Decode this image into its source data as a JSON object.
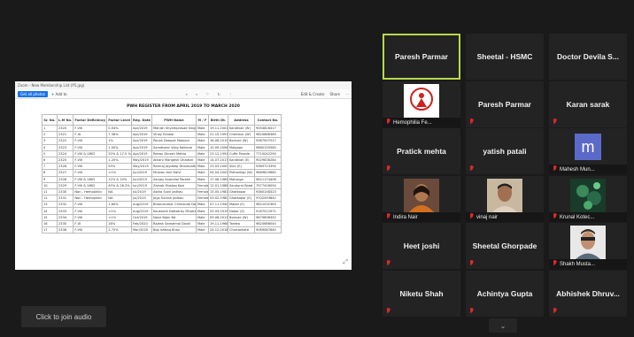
{
  "shared_window": {
    "titlebar": "Zoom - New Membership List (P5.jpg)",
    "toolbar": {
      "primary_btn": "Get all photos",
      "add": "+ Add to",
      "edit": "Edit & Create",
      "share": "Share"
    },
    "doc_title": "PWH REGISTER FROM APRIL 2019 TO MARCH 2020",
    "columns": [
      "Sr. No.",
      "L.M No.",
      "Factor Deficiency",
      "Factor Level",
      "Reg. Date",
      "PWH Name",
      "M / F",
      "Birth Dt.",
      "Address",
      "Contact No."
    ],
    "rows": [
      [
        "1",
        "2320",
        "F-VIII",
        "0.04%",
        "Apr/2019",
        "Manish Shyamprasad Singh",
        "Male",
        "19.11.2001",
        "Kandivali (W)",
        "9004826417"
      ],
      [
        "2",
        "2321",
        "F-IX",
        "7.36%",
        "Apr/2019",
        "Vinay Earwar",
        "Male",
        "21.10.1991",
        "Chembur (W)",
        "9820686389"
      ],
      [
        "3",
        "2322",
        "F-VIII",
        "1%",
        "Apr/2019",
        "Ponak Deepak Malpani",
        "Male",
        "16.08.2019",
        "Borivali (W)",
        "9987907517"
      ],
      [
        "4",
        "2323",
        "F-VIII",
        "1.00%",
        "Apr/2019",
        "Samdiseer Vijay Kolkane",
        "Male",
        "10.09.2006",
        "Malgaon",
        "9860155580"
      ],
      [
        "5",
        "2324",
        "F-VIII & VWD",
        "20% & 17.5 %",
        "Apr/2019",
        "Rohan Dinesh Mehta",
        "Male",
        "23.12.1991",
        "Cuffe Parade",
        "7710042290"
      ],
      [
        "6",
        "2325",
        "F-VIII",
        "1.20%",
        "May/2019",
        "Atharv Mangesh Ghadshi",
        "Male",
        "14.07.2017",
        "Kandivali (E)",
        "9029836284"
      ],
      [
        "7",
        "2326",
        "F-VIII",
        "59%",
        "May/2019",
        "Ramraj Jaydeep Dhoravatte",
        "Male",
        "23.03.2000",
        "Sion (E)",
        "9369723394"
      ],
      [
        "8",
        "2327",
        "F-VIII",
        "<1%",
        "Jun/2019",
        "Mravan Anil Dalvi",
        "Male",
        "04.04.2002",
        "Pidhonkap (W)",
        "9869819680"
      ],
      [
        "9",
        "2328",
        "F-VIII & VWD",
        "12% & 20%",
        "Jun/2019",
        "Sanjay Anandlal Parekh",
        "Male",
        "17.08.1965",
        "Matunga",
        "9821174406"
      ],
      [
        "10",
        "2329",
        "F-VIII & VWD",
        "45% & 26.3%",
        "Jun/2019",
        "Zainab Mustaq Kazi",
        "Female",
        "12.01.1986",
        "Sandurst Road",
        "7977416094"
      ],
      [
        "11",
        "2330",
        "Non - Hemophilic",
        "NA",
        "Jul/2019",
        "Astha Sunil Jadhav",
        "Female",
        "15.05.1981",
        "Ghatkopar",
        "9360148323"
      ],
      [
        "12",
        "2331",
        "Non - Hemophilic",
        "NA",
        "Jul/2019",
        "Jaya Suresh Jadhav",
        "Female",
        "03.02.1980",
        "Ghatkopar (E)",
        "9702493842"
      ],
      [
        "13",
        "2332",
        "F-VIII",
        "1.60%",
        "Aug/2019",
        "Bhanukumar Chimanlal Doshi",
        "Male",
        "07.11.1940",
        "Malad (E)",
        "9821032363"
      ],
      [
        "14",
        "2333",
        "F-VIII",
        "<1%",
        "Aug/2019",
        "Kaustubh Dattatray Mhatre",
        "Male",
        "25.03.2019",
        "Dadar (E)",
        "9167012971"
      ],
      [
        "15",
        "2334",
        "F-VIII",
        "<1%",
        "Oct/2019",
        "Nasir Bipin Bd",
        "Male",
        "09.06.2013",
        "Borivali (W)",
        "9879898352"
      ],
      [
        "16",
        "2335",
        "F-IX",
        "16%",
        "Feb/2020",
        "Rajesh Samalmal Doshi",
        "Male",
        "19.11.1966",
        "Tardeo",
        "9820686044"
      ],
      [
        "17",
        "2336",
        "F-VIII",
        "2.75%",
        "Mar/2020",
        "Biaj Ishtiaq Khan",
        "Male",
        "24.12.2018",
        "Chunabhatti",
        "9069087640"
      ]
    ]
  },
  "join_audio": "Click to join audio",
  "participants": [
    {
      "name": "Paresh Parmar",
      "kind": "name",
      "active": true
    },
    {
      "name": "Sheetal - HSMC",
      "kind": "name"
    },
    {
      "name": "Doctor Devila S...",
      "kind": "name"
    },
    {
      "name": "Hemophilia Fe...",
      "kind": "photo",
      "photo": "logo"
    },
    {
      "name": "Paresh Parmar",
      "kind": "name",
      "muted": true
    },
    {
      "name": "Karan sarak",
      "kind": "name",
      "muted": true
    },
    {
      "name": "Pratick mehta",
      "kind": "name",
      "muted": true
    },
    {
      "name": "yatish patali",
      "kind": "name",
      "muted": true
    },
    {
      "name": "Mahesh Mun...",
      "kind": "avatar",
      "letter": "m"
    },
    {
      "name": "Indira Nair",
      "kind": "photo",
      "photo": "woman"
    },
    {
      "name": "vinaj nair",
      "kind": "photo",
      "photo": "man"
    },
    {
      "name": "Krunal Kotec...",
      "kind": "photo",
      "photo": "nature"
    },
    {
      "name": "Heet joshi",
      "kind": "name",
      "muted": true
    },
    {
      "name": "Sheetal Ghorpade",
      "kind": "name",
      "muted": true
    },
    {
      "name": "Shakh Musta...",
      "kind": "photo",
      "photo": "man2"
    },
    {
      "name": "Niketu Shah",
      "kind": "name",
      "muted": true
    },
    {
      "name": "Achintya Gupta",
      "kind": "name",
      "muted": true
    },
    {
      "name": "Abhishek Dhruv...",
      "kind": "name",
      "muted": true
    }
  ],
  "colors": {
    "active_border": "#b8d94a",
    "mute": "#e02828",
    "avatar": "#5b6ac9"
  }
}
